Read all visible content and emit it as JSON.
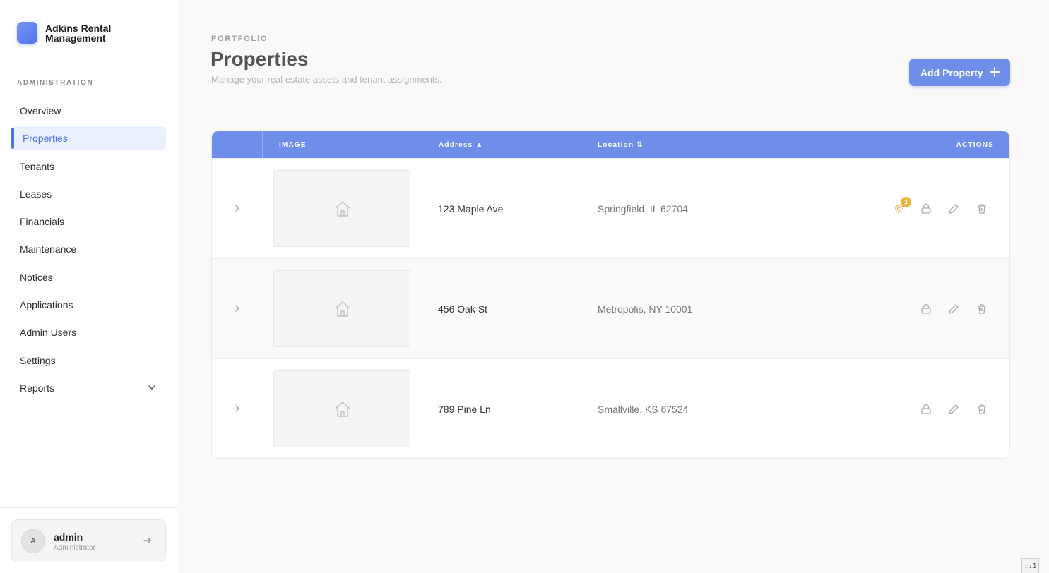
{
  "brand": {
    "name": "Adkins Rental Management"
  },
  "sidebar": {
    "section_label": "ADMINISTRATION",
    "items": [
      {
        "label": "Overview",
        "active": false
      },
      {
        "label": "Properties",
        "active": true
      },
      {
        "label": "Tenants",
        "active": false
      },
      {
        "label": "Leases",
        "active": false
      },
      {
        "label": "Financials",
        "active": false
      },
      {
        "label": "Maintenance",
        "active": false
      },
      {
        "label": "Notices",
        "active": false
      },
      {
        "label": "Applications",
        "active": false
      },
      {
        "label": "Admin Users",
        "active": false
      },
      {
        "label": "Settings",
        "active": false
      },
      {
        "label": "Reports",
        "active": false
      }
    ]
  },
  "user": {
    "initial": "A",
    "name": "admin",
    "role": "Administrator"
  },
  "header": {
    "eyebrow": "PORTFOLIO",
    "title": "Properties",
    "subtitle": "Manage your real estate assets and tenant assignments.",
    "add_button": "Add Property"
  },
  "table": {
    "columns": [
      "IMAGE",
      "Address ▲",
      "Location ⇅",
      "ACTIONS"
    ],
    "rows": [
      {
        "address": "123 Maple Ave",
        "location": "Springfield, IL 62704",
        "badge": "2"
      },
      {
        "address": "456 Oak St",
        "location": "Metropolis, NY 10001"
      },
      {
        "address": "789 Pine Ln",
        "location": "Smallville, KS 67524"
      }
    ]
  },
  "corner_label": "::1",
  "colors": {
    "accent": "#6f8ee9",
    "active_bg": "#eaf0fd",
    "badge": "#f0b338"
  }
}
